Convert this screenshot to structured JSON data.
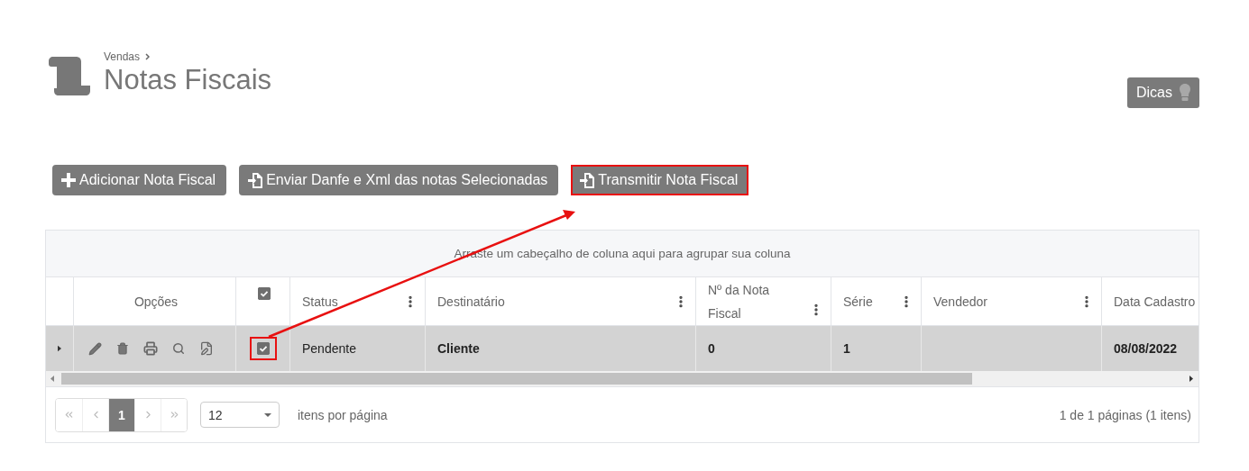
{
  "breadcrumb": {
    "label": "Vendas"
  },
  "title": "Notas Fiscais",
  "tips_button": {
    "label": "Dicas"
  },
  "actions": [
    {
      "label": "Adicionar Nota Fiscal",
      "kind": "add",
      "highlighted": false
    },
    {
      "label": "Enviar Danfe e Xml das notas Selecionadas",
      "kind": "export",
      "highlighted": false
    },
    {
      "label": "Transmitir Nota Fiscal",
      "kind": "export",
      "highlighted": true
    }
  ],
  "grid": {
    "group_panel": "Arraste um cabeçalho de coluna aqui para agrupar sua coluna",
    "options_label": "Opções",
    "select_all": {
      "checked": true
    },
    "columns": [
      {
        "label": "Status",
        "menu": true
      },
      {
        "label": "Destinatário",
        "menu": true
      },
      {
        "label": "Nº da Nota Fiscal",
        "menu": true
      },
      {
        "label": "Série",
        "menu": true
      },
      {
        "label": "Vendedor",
        "menu": true
      },
      {
        "label": "Data Cadastro",
        "menu": false
      }
    ],
    "rows": [
      {
        "selected": true,
        "expanded": false,
        "checked": true,
        "highlighted": true,
        "cells": [
          {
            "text": "Pendente",
            "bold": false
          },
          {
            "text": "Cliente",
            "bold": true
          },
          {
            "text": "0",
            "bold": true
          },
          {
            "text": "1",
            "bold": true
          },
          null,
          {
            "text": "08/08/2022",
            "bold": true
          }
        ]
      }
    ]
  },
  "pager": {
    "pages": [
      {
        "label": "1",
        "selected": true
      }
    ],
    "page_size": "12",
    "page_size_label": "itens por página",
    "summary": "1 de 1 páginas (1 itens)"
  }
}
